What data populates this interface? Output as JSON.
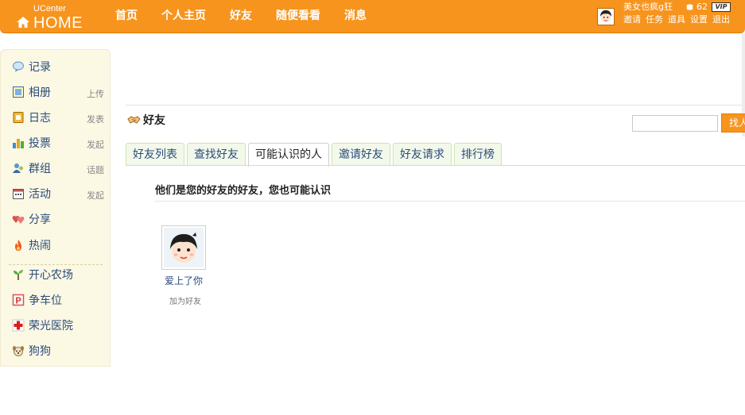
{
  "header": {
    "logo_small": "UCenter",
    "logo_big": "HOME",
    "nav": [
      "首页",
      "个人主页",
      "好友",
      "随便看看",
      "消息"
    ],
    "user_name": "美女也疯g狂",
    "credit": "62",
    "vip_label": "VIP",
    "user_links": [
      "邀请",
      "任务",
      "道具",
      "设置",
      "退出"
    ]
  },
  "sidebar": {
    "items": [
      {
        "label": "记录",
        "action": "",
        "icon": "speech-bubble-icon"
      },
      {
        "label": "相册",
        "action": "上传",
        "icon": "picture-icon"
      },
      {
        "label": "日志",
        "action": "发表",
        "icon": "notebook-icon"
      },
      {
        "label": "投票",
        "action": "发起",
        "icon": "bar-chart-icon"
      },
      {
        "label": "群组",
        "action": "话题",
        "icon": "group-icon"
      },
      {
        "label": "活动",
        "action": "发起",
        "icon": "calendar-icon"
      },
      {
        "label": "分享",
        "action": "",
        "icon": "hearts-icon"
      },
      {
        "label": "热闹",
        "action": "",
        "icon": "fire-icon"
      },
      {
        "label": "开心农场",
        "action": "",
        "icon": "sprout-icon"
      },
      {
        "label": "争车位",
        "action": "",
        "icon": "parking-icon"
      },
      {
        "label": "荣光医院",
        "action": "",
        "icon": "red-cross-icon"
      },
      {
        "label": "狗狗",
        "action": "",
        "icon": "dog-icon"
      }
    ]
  },
  "content": {
    "section_title": "好友",
    "search_placeholder": "",
    "search_button": "找人",
    "tabs": [
      "好友列表",
      "查找好友",
      "可能认识的人",
      "邀请好友",
      "好友请求",
      "排行榜"
    ],
    "active_tab": "可能认识的人",
    "subheading": "他们是您的好友的好友，您也可能认识",
    "friends": [
      {
        "name": "爱上了你",
        "action": "加为好友"
      }
    ]
  },
  "colors": {
    "header_orange": "#f7941d",
    "link_blue": "#2a4b7c",
    "sidebar_bg": "#fbf8e4",
    "tab_green_border": "#cde4b5"
  }
}
